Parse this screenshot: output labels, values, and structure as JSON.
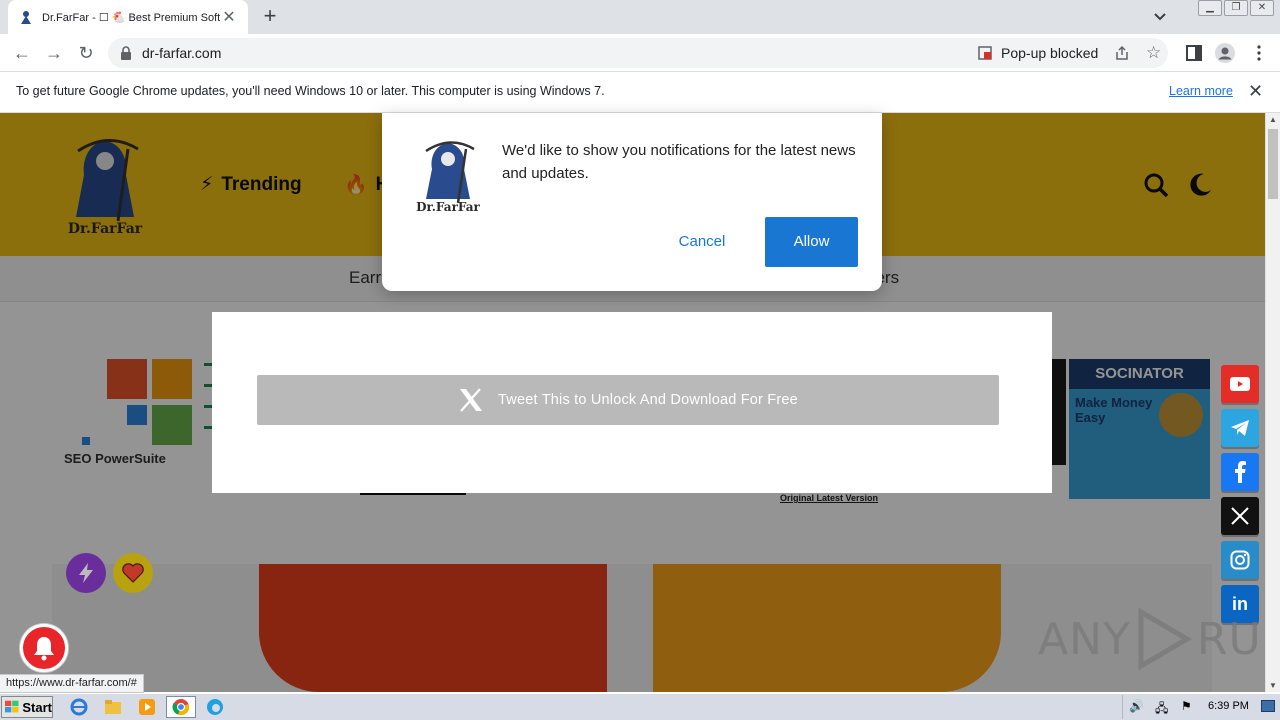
{
  "browser": {
    "tab_title": "Dr.FarFar - ☐ 🐔 Best Premium Softw",
    "url": "dr-farfar.com",
    "popup_blocked": "Pop-up blocked",
    "status_url": "https://www.dr-farfar.com/#"
  },
  "infobar": {
    "message": "To get future Google Chrome updates, you'll need Windows 10 or later. This computer is using Windows 7.",
    "learn_more": "Learn more"
  },
  "site": {
    "logo_text": "Dr.FarFar",
    "nav": [
      {
        "label": "Trending"
      },
      {
        "label": "H"
      }
    ],
    "subnav_left": "Earr",
    "subnav_right": "pers",
    "card_caption": "Original Latest Version",
    "card_brand": "SOCINATOR",
    "card_tag": "Make Money Easy",
    "seo_label": "SEO PowerSuite"
  },
  "notification": {
    "logo_text": "Dr.FarFar",
    "message": "We'd like to show you notifications for the latest news and updates.",
    "cancel": "Cancel",
    "allow": "Allow"
  },
  "locker": {
    "tweet_label": "Tweet This to Unlock And Download For Free"
  },
  "social": [
    {
      "name": "youtube",
      "color": "#e52d27"
    },
    {
      "name": "telegram",
      "color": "#2ca5e0"
    },
    {
      "name": "facebook",
      "color": "#1877f2"
    },
    {
      "name": "x",
      "color": "#111111"
    },
    {
      "name": "instagram",
      "color": "#2a8bc9"
    },
    {
      "name": "linkedin",
      "color": "#0a66c2"
    }
  ],
  "social_label_in": "in",
  "watermark": {
    "left": "ANY",
    "right": "RUN"
  },
  "taskbar": {
    "start": "Start",
    "time": "6:39 PM"
  }
}
